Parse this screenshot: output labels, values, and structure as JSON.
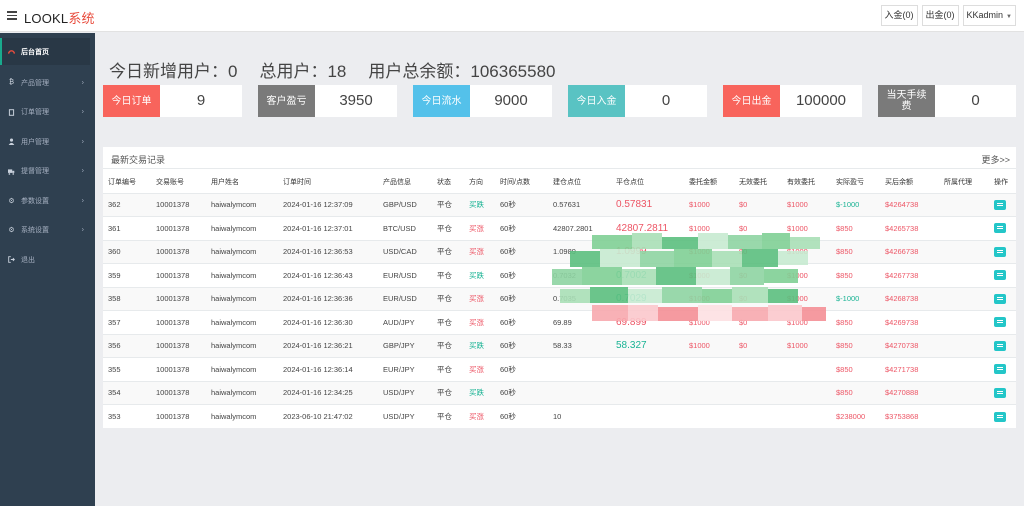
{
  "header": {
    "brand_main": "LOOKL",
    "brand_accent": "系统",
    "deposit_label": "入金(0)",
    "withdraw_label": "出金(0)",
    "user_label": "KKadmin"
  },
  "sidebar": {
    "items": [
      {
        "label": "后台首页",
        "icon": "dashboard-icon"
      },
      {
        "label": "产品管理",
        "icon": "bitcoin-icon"
      },
      {
        "label": "订单管理",
        "icon": "file-icon"
      },
      {
        "label": "用户管理",
        "icon": "user-icon"
      },
      {
        "label": "提督管理",
        "icon": "truck-icon"
      },
      {
        "label": "参数设置",
        "icon": "gear-icon"
      },
      {
        "label": "系统设置",
        "icon": "gears-icon"
      },
      {
        "label": "退出",
        "icon": "exit-icon"
      }
    ]
  },
  "summary": {
    "today_new_label": "今日新增用户：",
    "today_new": "0",
    "total_users_label": "总用户：",
    "total_users": "18",
    "balance_label": "用户总余额：",
    "balance": "106365580"
  },
  "stats": [
    {
      "label": "今日订单",
      "value": "9",
      "color": "#f8645c"
    },
    {
      "label": "客户盈亏",
      "value": "3950",
      "color": "#7a7a7a"
    },
    {
      "label": "今日流水",
      "value": "9000",
      "color": "#54c1ea"
    },
    {
      "label": "今日入金",
      "value": "0",
      "color": "#59c3c3"
    },
    {
      "label": "今日出金",
      "value": "100000",
      "color": "#f8645c"
    },
    {
      "label": "当天手续费",
      "value": "0",
      "color": "#7a7a7a"
    }
  ],
  "panel": {
    "title": "最新交易记录",
    "more": "更多>>"
  },
  "table": {
    "columns": [
      "订单编号",
      "交易账号",
      "用户姓名",
      "订单时间",
      "产品信息",
      "状态",
      "方向",
      "时间/点数",
      "建仓点位",
      "平仓点位",
      "委托金额",
      "无效委托",
      "有效委托",
      "实际盈亏",
      "买后余额",
      "所属代理",
      "操作"
    ],
    "rows": [
      {
        "id": "362",
        "account": "10001378",
        "name": "haiwalymcom",
        "time": "2024-01-16 12:37:09",
        "product": "GBP/USD",
        "status": "平仓",
        "dir": "买跌",
        "dur": "60秒",
        "open": "0.57631",
        "close": "0.57831",
        "amount": "$1000",
        "invalid": "$0",
        "valid": "$1000",
        "profit": "$-1000",
        "balance": "$4264738",
        "agent": ""
      },
      {
        "id": "361",
        "account": "10001378",
        "name": "haiwalymcom",
        "time": "2024-01-16 12:37:01",
        "product": "BTC/USD",
        "status": "平仓",
        "dir": "买涨",
        "dur": "60秒",
        "open": "42807.2801",
        "close": "42807.2811",
        "amount": "$1000",
        "invalid": "$0",
        "valid": "$1000",
        "profit": "$850",
        "balance": "$4265738",
        "agent": ""
      },
      {
        "id": "360",
        "account": "10001378",
        "name": "haiwalymcom",
        "time": "2024-01-16 12:36:53",
        "product": "USD/CAD",
        "status": "平仓",
        "dir": "买涨",
        "dur": "60秒",
        "open": "1.0989",
        "close": "1.0999",
        "amount": "$1000",
        "invalid": "$0",
        "valid": "$1000",
        "profit": "$850",
        "balance": "$4266738",
        "agent": ""
      },
      {
        "id": "359",
        "account": "10001378",
        "name": "haiwalymcom",
        "time": "2024-01-16 12:36:43",
        "product": "EUR/USD",
        "status": "平仓",
        "dir": "买跌",
        "dur": "60秒",
        "open": "0.7032",
        "close": "0.7002",
        "amount": "$1000",
        "invalid": "$0",
        "valid": "$1000",
        "profit": "$850",
        "balance": "$4267738",
        "agent": ""
      },
      {
        "id": "358",
        "account": "10001378",
        "name": "haiwalymcom",
        "time": "2024-01-16 12:36:36",
        "product": "EUR/USD",
        "status": "平仓",
        "dir": "买涨",
        "dur": "60秒",
        "open": "0.7035",
        "close": "0.7029",
        "amount": "$1000",
        "invalid": "$0",
        "valid": "$1000",
        "profit": "$-1000",
        "balance": "$4268738",
        "agent": ""
      },
      {
        "id": "357",
        "account": "10001378",
        "name": "haiwalymcom",
        "time": "2024-01-16 12:36:30",
        "product": "AUD/JPY",
        "status": "平仓",
        "dir": "买涨",
        "dur": "60秒",
        "open": "69.89",
        "close": "69.899",
        "amount": "$1000",
        "invalid": "$0",
        "valid": "$1000",
        "profit": "$850",
        "balance": "$4269738",
        "agent": ""
      },
      {
        "id": "356",
        "account": "10001378",
        "name": "haiwalymcom",
        "time": "2024-01-16 12:36:21",
        "product": "GBP/JPY",
        "status": "平仓",
        "dir": "买跌",
        "dur": "60秒",
        "open": "58.33",
        "close": "58.327",
        "amount": "$1000",
        "invalid": "$0",
        "valid": "$1000",
        "profit": "$850",
        "balance": "$4270738",
        "agent": ""
      },
      {
        "id": "355",
        "account": "10001378",
        "name": "haiwalymcom",
        "time": "2024-01-16 12:36:14",
        "product": "EUR/JPY",
        "status": "平仓",
        "dir": "买涨",
        "dur": "60秒",
        "open": "",
        "close": "",
        "amount": "",
        "invalid": "",
        "valid": "",
        "profit": "$850",
        "balance": "$4271738",
        "agent": ""
      },
      {
        "id": "354",
        "account": "10001378",
        "name": "haiwalymcom",
        "time": "2024-01-16 12:34:25",
        "product": "USD/JPY",
        "status": "平仓",
        "dir": "买跌",
        "dur": "60秒",
        "open": "",
        "close": "",
        "amount": "",
        "invalid": "",
        "valid": "",
        "profit": "$850",
        "balance": "$4270888",
        "agent": ""
      },
      {
        "id": "353",
        "account": "10001378",
        "name": "haiwalymcom",
        "time": "2023-06-10 21:47:02",
        "product": "USD/JPY",
        "status": "平仓",
        "dir": "买涨",
        "dur": "60秒",
        "open": "10",
        "close": "",
        "amount": "",
        "invalid": "",
        "valid": "",
        "profit": "$238000",
        "balance": "$3753868",
        "agent": ""
      }
    ]
  }
}
